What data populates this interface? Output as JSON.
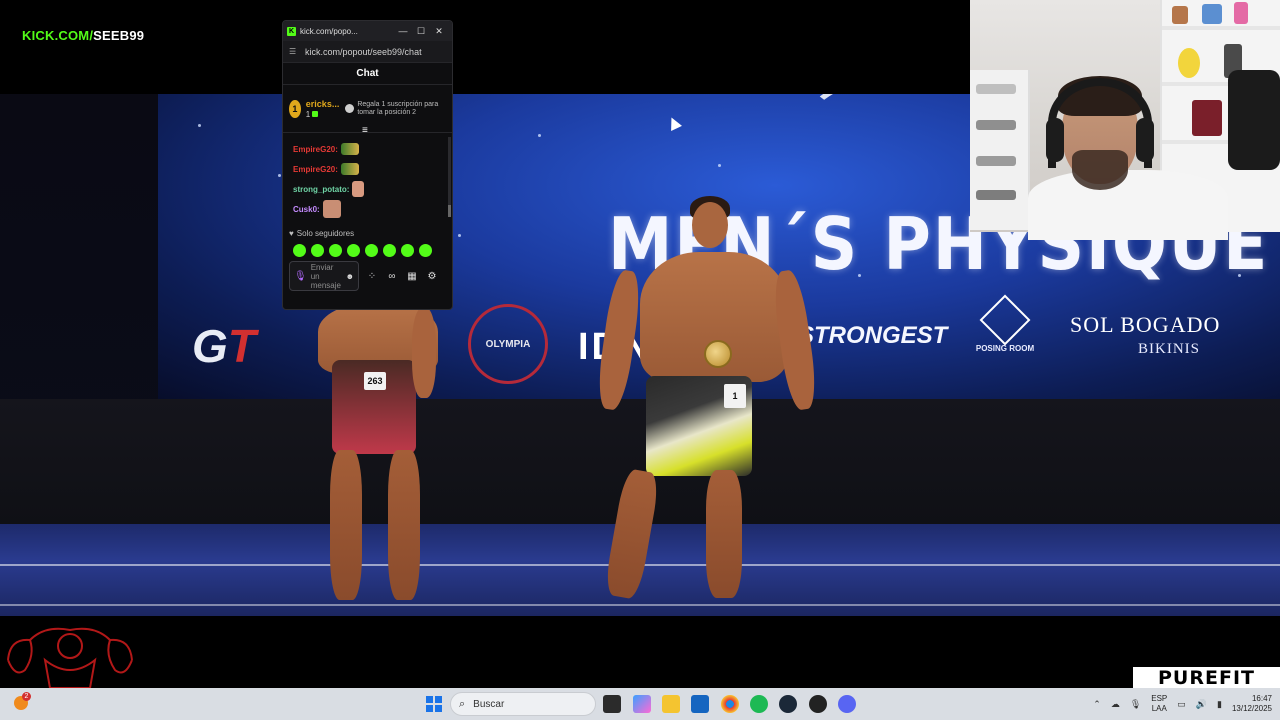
{
  "overlay": {
    "stream_url_prefix": "KICK.COM/",
    "stream_handle": "SEEB99"
  },
  "video": {
    "headline": "MEN´S PHYSIQUE",
    "sponsors": {
      "gt": "G",
      "gt_t": "T",
      "olympia": "OLYMPIA",
      "ion": "IDN",
      "strongest": "STRONGEST",
      "posing_room": "POSING ROOM",
      "sol_bogado": "SOL BOGADO",
      "bikinis": "BIKINIS"
    },
    "athletes": [
      {
        "bib": "263"
      },
      {
        "bib": "1"
      }
    ]
  },
  "chat_window": {
    "title": "kick.com/popo...",
    "url": "kick.com/popout/seeb99/chat",
    "header": "Chat",
    "pinned": {
      "rank": "1",
      "user": "ericks...",
      "count": "1",
      "gift_text": "Regala 1 suscripción para tomar la posición 2"
    },
    "messages": [
      {
        "user": "EmpireG20:",
        "color": "#e53935"
      },
      {
        "user": "EmpireG20:",
        "color": "#e53935"
      },
      {
        "user": "strong_potato:",
        "color": "#6fd3a5"
      },
      {
        "user": "Cusk0:",
        "color": "#c58bff"
      }
    ],
    "followers_only": "Solo seguidores",
    "input_placeholder": "Enviar un mensaje",
    "colors": {
      "accent": "#53fc18",
      "gold": "#e0a81c"
    }
  },
  "brand": "PUREFIT",
  "taskbar": {
    "badge_count": "2",
    "search_placeholder": "Buscar",
    "lang_top": "ESP",
    "lang_bottom": "LAA",
    "time": "16:47",
    "date": "13/12/2025"
  }
}
